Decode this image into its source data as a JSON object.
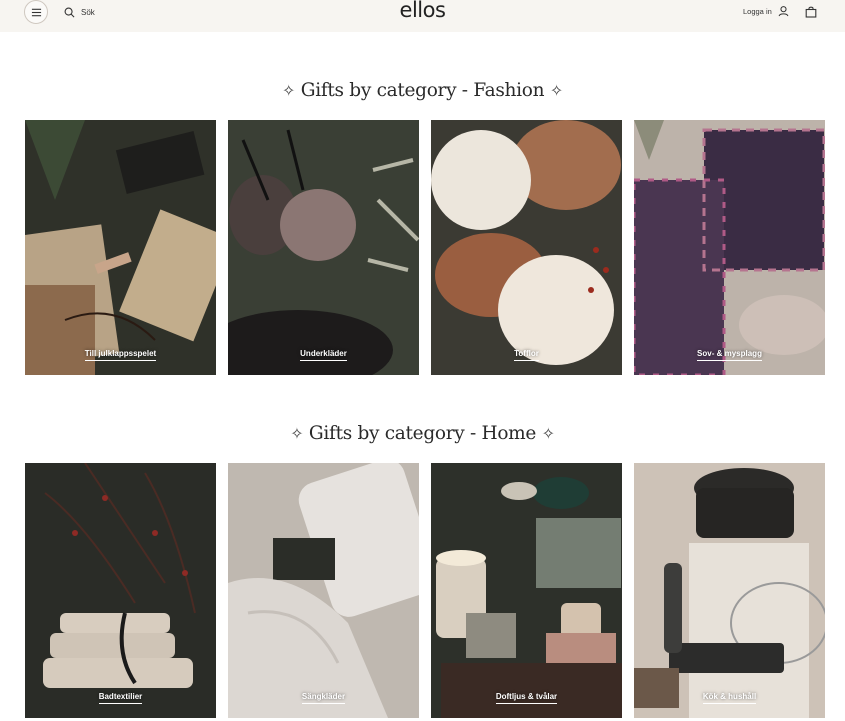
{
  "header": {
    "menu_icon": "hamburger-icon",
    "search_label": "Sök",
    "logo": "ellos",
    "login_label": "Logga in",
    "user_icon": "user-icon",
    "cart_icon": "bag-icon"
  },
  "sections": [
    {
      "title": "Gifts by category - Fashion",
      "sparkle": "✧",
      "tiles": [
        {
          "label": "Till julklappsspelet",
          "bg": "#2f3129"
        },
        {
          "label": "Underkläder",
          "bg": "#3a3f35"
        },
        {
          "label": "Tofflor",
          "bg": "#3b3a33"
        },
        {
          "label": "Sov- & mysplagg",
          "bg": "#bdb3aa"
        }
      ]
    },
    {
      "title": "Gifts by category - Home",
      "sparkle": "✧",
      "tiles": [
        {
          "label": "Badtextilier",
          "bg": "#2a2c27"
        },
        {
          "label": "Sängkläder",
          "bg": "#bfb8b0"
        },
        {
          "label": "Doftljus & tvålar",
          "bg": "#2d302a"
        },
        {
          "label": "Kök & hushåll",
          "bg": "#cdc2b7"
        }
      ]
    }
  ]
}
